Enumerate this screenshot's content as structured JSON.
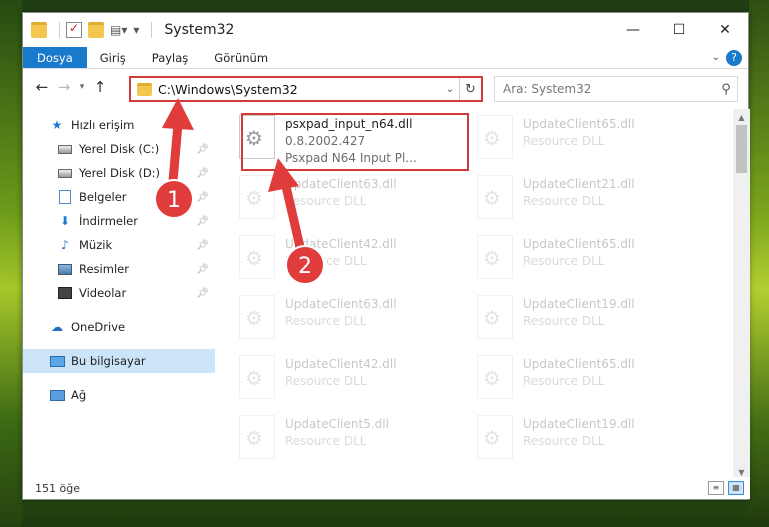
{
  "window": {
    "title": "System32"
  },
  "ribbon": {
    "tabs": [
      "Dosya",
      "Giriş",
      "Paylaş",
      "Görünüm"
    ]
  },
  "address": {
    "path": "C:\\Windows\\System32"
  },
  "search": {
    "placeholder": "Ara: System32"
  },
  "sidebar": {
    "items": [
      {
        "label": "Hızlı erişim",
        "icon": "star-icon",
        "pinned": false
      },
      {
        "label": "Yerel Disk (C:)",
        "icon": "disk-icon",
        "pinned": true
      },
      {
        "label": "Yerel Disk (D:)",
        "icon": "disk-icon",
        "pinned": true
      },
      {
        "label": "Belgeler",
        "icon": "documents-icon",
        "pinned": true
      },
      {
        "label": "İndirmeler",
        "icon": "downloads-icon",
        "pinned": true
      },
      {
        "label": "Müzik",
        "icon": "music-icon",
        "pinned": true
      },
      {
        "label": "Resimler",
        "icon": "pictures-icon",
        "pinned": true
      },
      {
        "label": "Videolar",
        "icon": "videos-icon",
        "pinned": true
      },
      {
        "label": "OneDrive",
        "icon": "cloud-icon",
        "pinned": false
      },
      {
        "label": "Bu bilgisayar",
        "icon": "computer-icon",
        "pinned": false,
        "selected": true
      },
      {
        "label": "Ağ",
        "icon": "network-icon",
        "pinned": false
      }
    ]
  },
  "files": [
    {
      "name": "psxpad_input_n64.dll",
      "line2": "0.8.2002.427",
      "line3": "Psxpad N64 Input Pl...",
      "faded": false
    },
    {
      "name": "UpdateClient65.dll",
      "line2": "Resource DLL",
      "faded": true
    },
    {
      "name": "UpdateClient63.dll",
      "line2": "Resource DLL",
      "faded": true
    },
    {
      "name": "UpdateClient21.dll",
      "line2": "Resource DLL",
      "faded": true
    },
    {
      "name": "UpdateClient42.dll",
      "line2": "Resource DLL",
      "faded": true
    },
    {
      "name": "UpdateClient65.dll",
      "line2": "Resource DLL",
      "faded": true
    },
    {
      "name": "UpdateClient63.dll",
      "line2": "Resource DLL",
      "faded": true
    },
    {
      "name": "UpdateClient19.dll",
      "line2": "Resource DLL",
      "faded": true
    },
    {
      "name": "UpdateClient42.dll",
      "line2": "Resource DLL",
      "faded": true
    },
    {
      "name": "UpdateClient65.dll",
      "line2": "Resource DLL",
      "faded": true
    },
    {
      "name": "UpdateClient5.dll",
      "line2": "Resource DLL",
      "faded": true
    },
    {
      "name": "UpdateClient19.dll",
      "line2": "Resource DLL",
      "faded": true
    }
  ],
  "status": {
    "count": "151 öğe"
  },
  "annotations": {
    "badge1": "1",
    "badge2": "2",
    "color": "#e03c3c"
  }
}
